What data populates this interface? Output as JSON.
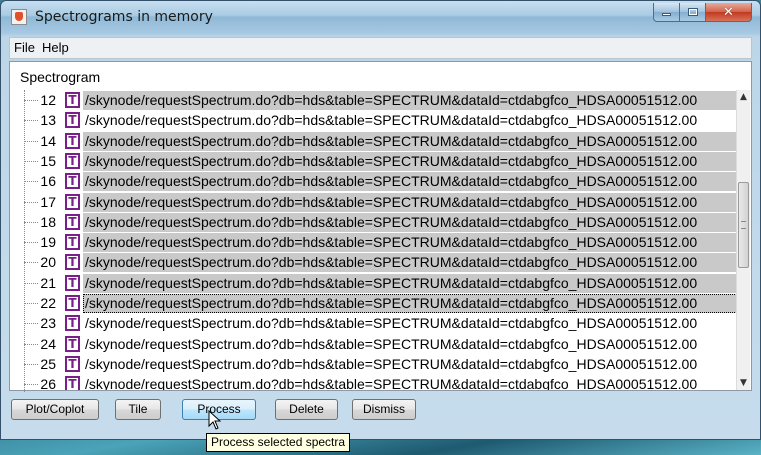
{
  "window": {
    "title": "Spectrograms in memory",
    "accent": "#7a1f8a"
  },
  "menu": {
    "items": [
      "File",
      "Help"
    ]
  },
  "tree": {
    "header": "Spectrogram",
    "rows": [
      {
        "num": "12",
        "type": "T",
        "path": "/skynode/requestSpectrum.do?db=hds&table=SPECTRUM&dataId=ctdabgfco_HDSA00051512.00",
        "selected": true
      },
      {
        "num": "13",
        "type": "T",
        "path": "/skynode/requestSpectrum.do?db=hds&table=SPECTRUM&dataId=ctdabgfco_HDSA00051512.00",
        "selected": false
      },
      {
        "num": "14",
        "type": "T",
        "path": "/skynode/requestSpectrum.do?db=hds&table=SPECTRUM&dataId=ctdabgfco_HDSA00051512.00",
        "selected": true
      },
      {
        "num": "15",
        "type": "T",
        "path": "/skynode/requestSpectrum.do?db=hds&table=SPECTRUM&dataId=ctdabgfco_HDSA00051512.00",
        "selected": true
      },
      {
        "num": "16",
        "type": "T",
        "path": "/skynode/requestSpectrum.do?db=hds&table=SPECTRUM&dataId=ctdabgfco_HDSA00051512.00",
        "selected": true
      },
      {
        "num": "17",
        "type": "T",
        "path": "/skynode/requestSpectrum.do?db=hds&table=SPECTRUM&dataId=ctdabgfco_HDSA00051512.00",
        "selected": true
      },
      {
        "num": "18",
        "type": "T",
        "path": "/skynode/requestSpectrum.do?db=hds&table=SPECTRUM&dataId=ctdabgfco_HDSA00051512.00",
        "selected": true
      },
      {
        "num": "19",
        "type": "T",
        "path": "/skynode/requestSpectrum.do?db=hds&table=SPECTRUM&dataId=ctdabgfco_HDSA00051512.00",
        "selected": true
      },
      {
        "num": "20",
        "type": "T",
        "path": "/skynode/requestSpectrum.do?db=hds&table=SPECTRUM&dataId=ctdabgfco_HDSA00051512.00",
        "selected": true
      },
      {
        "num": "21",
        "type": "T",
        "path": "/skynode/requestSpectrum.do?db=hds&table=SPECTRUM&dataId=ctdabgfco_HDSA00051512.00",
        "selected": true
      },
      {
        "num": "22",
        "type": "T",
        "path": "/skynode/requestSpectrum.do?db=hds&table=SPECTRUM&dataId=ctdabgfco_HDSA00051512.00",
        "selected": true,
        "focused": true
      },
      {
        "num": "23",
        "type": "T",
        "path": "/skynode/requestSpectrum.do?db=hds&table=SPECTRUM&dataId=ctdabgfco_HDSA00051512.00",
        "selected": false
      },
      {
        "num": "24",
        "type": "T",
        "path": "/skynode/requestSpectrum.do?db=hds&table=SPECTRUM&dataId=ctdabgfco_HDSA00051512.00",
        "selected": false
      },
      {
        "num": "25",
        "type": "T",
        "path": "/skynode/requestSpectrum.do?db=hds&table=SPECTRUM&dataId=ctdabgfco_HDSA00051512.00",
        "selected": false
      },
      {
        "num": "26",
        "type": "T",
        "path": "/skynode/requestSpectrum.do?db=hds&table=SPECTRUM&dataId=ctdabgfco_HDSA00051512.00",
        "selected": false
      }
    ]
  },
  "buttons": {
    "plot": "Plot/Coplot",
    "tile": "Tile",
    "process": "Process",
    "delete": "Delete",
    "dismiss": "Dismiss"
  },
  "tooltip": {
    "text": "Process selected spectra"
  },
  "icons": {
    "app": "java-cup-icon",
    "type": "table-icon",
    "cursor": "mouse-pointer-icon"
  }
}
